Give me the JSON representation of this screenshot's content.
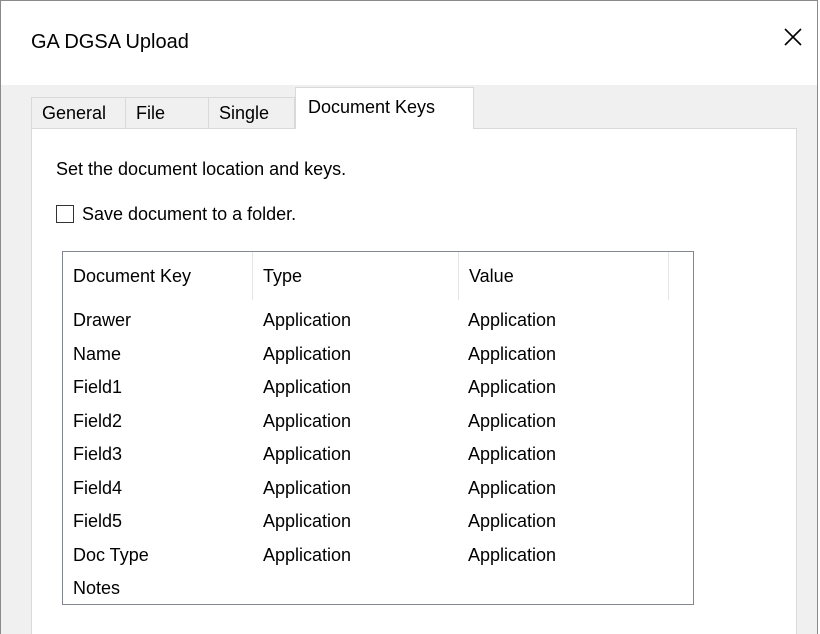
{
  "window": {
    "title": "GA DGSA Upload"
  },
  "tabs": [
    {
      "label": "General"
    },
    {
      "label": "File"
    },
    {
      "label": "Single"
    },
    {
      "label": "Document Keys"
    }
  ],
  "panel": {
    "instructions": "Set the document location and keys.",
    "save_checkbox_label": "Save document to a folder.",
    "save_checkbox_checked": false
  },
  "table": {
    "columns": [
      "Document Key",
      "Type",
      "Value"
    ],
    "rows": [
      {
        "key": "Drawer",
        "type": "Application",
        "value": "Application"
      },
      {
        "key": "Name",
        "type": "Application",
        "value": "Application"
      },
      {
        "key": "Field1",
        "type": "Application",
        "value": "Application"
      },
      {
        "key": "Field2",
        "type": "Application",
        "value": "Application"
      },
      {
        "key": "Field3",
        "type": "Application",
        "value": "Application"
      },
      {
        "key": "Field4",
        "type": "Application",
        "value": "Application"
      },
      {
        "key": "Field5",
        "type": "Application",
        "value": "Application"
      },
      {
        "key": "Doc Type",
        "type": "Application",
        "value": "Application"
      },
      {
        "key": "Notes",
        "type": "",
        "value": ""
      }
    ]
  },
  "icons": {
    "close": "close-icon"
  }
}
